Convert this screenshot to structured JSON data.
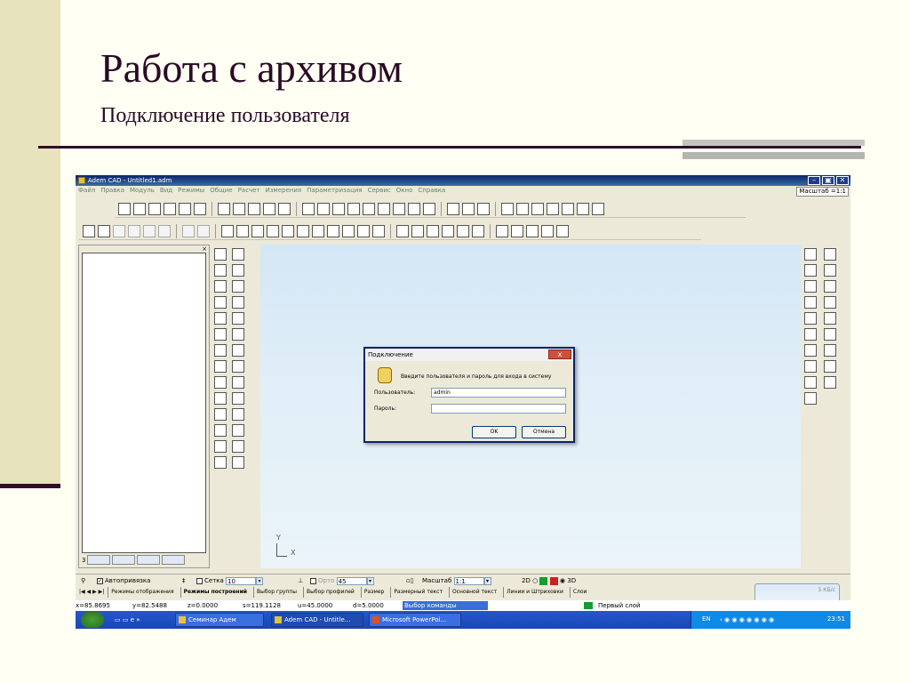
{
  "slide": {
    "title": "Работа с архивом",
    "subtitle": "Подключение пользователя"
  },
  "app": {
    "window_title": "Adem CAD - Untitled1.adm",
    "menu": [
      "Файл",
      "Правка",
      "Модуль",
      "Вид",
      "Режимы",
      "Общие",
      "Расчет",
      "Измерения",
      "Параметризация",
      "Сервис",
      "Окно",
      "Справка"
    ],
    "scale_label": "Масштаб =1:1"
  },
  "left_panel": {
    "tab_number": "3"
  },
  "canvas": {
    "axis_y": "Y",
    "axis_x": "X"
  },
  "dialog": {
    "title": "Подключение",
    "close_label": "x",
    "message": "Введите пользователя и пароль для входа в систему",
    "user_label": "Пользователь:",
    "user_value": "admin",
    "password_label": "Пароль:",
    "password_value": "",
    "ok_label": "OK",
    "cancel_label": "Отмена"
  },
  "status_bar": {
    "snap_label": "Автопривязка",
    "snap_checked": true,
    "grid_label": "Сетка",
    "grid_value": "10",
    "ortho_label": "Орто",
    "ortho_value": "45",
    "scale_label": "Масштаб",
    "scale_value": "1:1",
    "mode_2d": "2D",
    "mode_3d": "3D"
  },
  "mode_tabs": [
    "Режимы отображения",
    "Режимы построений",
    "Выбор группы",
    "Выбор профилей",
    "Размер",
    "Размерный текст",
    "Основной текст",
    "Линии и Штриховки",
    "Слои"
  ],
  "active_mode_tab": "Режимы построений",
  "notice": {
    "label": "5 КБ/с"
  },
  "coords": {
    "x": "x=85.8695",
    "y": "y=82.5488",
    "z": "z=0.0000",
    "s": "s=119.1128",
    "u": "u=45.0000",
    "d": "d=5.0000",
    "command": "Выбор команды",
    "layer": "Первый слой"
  },
  "taskbar": {
    "tasks": [
      "Семинар Адем",
      "Adem CAD - Untitle...",
      "Microsoft PowerPoi..."
    ],
    "lang": "EN",
    "clock": "23:51"
  },
  "colors": {
    "accent_dark": "#2f0f2a",
    "slide_band": "#e7e3bd",
    "canvas_bg": "#dfeef8",
    "titlebar": "#0a246a",
    "taskbar": "#1a46b5",
    "command_highlight": "#3a6ed8",
    "layer_color": "#10a030"
  }
}
